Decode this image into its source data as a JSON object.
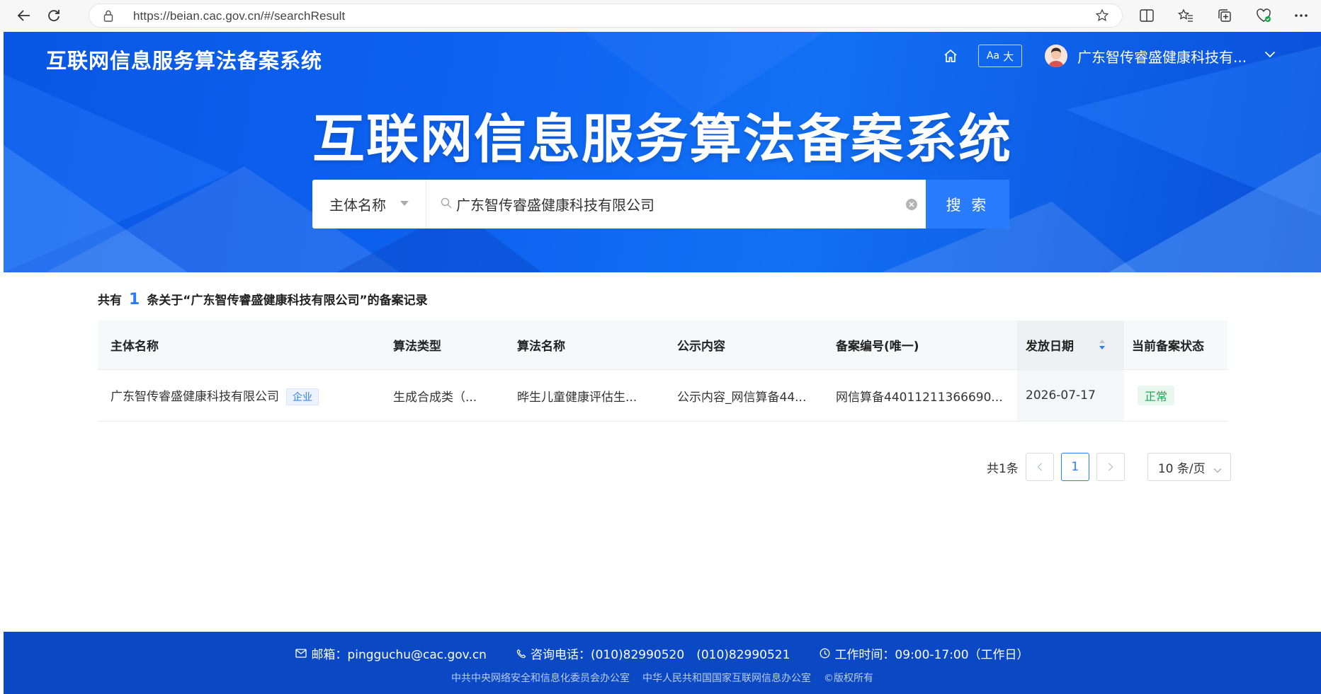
{
  "browser": {
    "url": "https://beian.cac.gov.cn/#/searchResult"
  },
  "header": {
    "site_name": "互联网信息服务算法备案系统",
    "font_size_button": {
      "aa": "Aa",
      "big": "大"
    },
    "user_name": "广东智传睿盛健康科技有..."
  },
  "hero": {
    "title": "互联网信息服务算法备案系统"
  },
  "search": {
    "type_selected": "主体名称",
    "query": "广东智传睿盛健康科技有限公司",
    "button_label": "搜 索"
  },
  "results": {
    "summary_prefix": "共有",
    "count": "1",
    "summary_suffix": "条关于“广东智传睿盛健康科技有限公司”的备案记录",
    "columns": [
      "主体名称",
      "算法类型",
      "算法名称",
      "公示内容",
      "备案编号(唯一)",
      "发放日期",
      "当前备案状态"
    ],
    "rows": [
      {
        "entity": "广东智传睿盛健康科技有限公司",
        "entity_tag": "企业",
        "algo_type": "生成合成类（...",
        "algo_name": "晔生儿童健康评估生...",
        "public_content": "公示内容_网信算备44...",
        "record_no": "网信算备44011211366690...",
        "issue_date": "2026-07-17",
        "status": "正常"
      }
    ]
  },
  "pagination": {
    "total": "共1条",
    "current_page": "1",
    "page_size": "10 条/页"
  },
  "footer": {
    "email": "邮箱：pingguchu@cac.gov.cn",
    "phone": "咨询电话：(010)82990520　(010)82990521",
    "hours": "工作时间：09:00-17:00（工作日）",
    "org1": "中共中央网络安全和信息化委员会办公室",
    "org2": "中华人民共和国国家互联网信息办公室",
    "copyright": "©版权所有"
  },
  "colors": {
    "primary_blue": "#2a7cff",
    "hero_blue": "#0d62f0",
    "footer_blue": "#0a48c4",
    "status_green": "#1aaa55"
  }
}
